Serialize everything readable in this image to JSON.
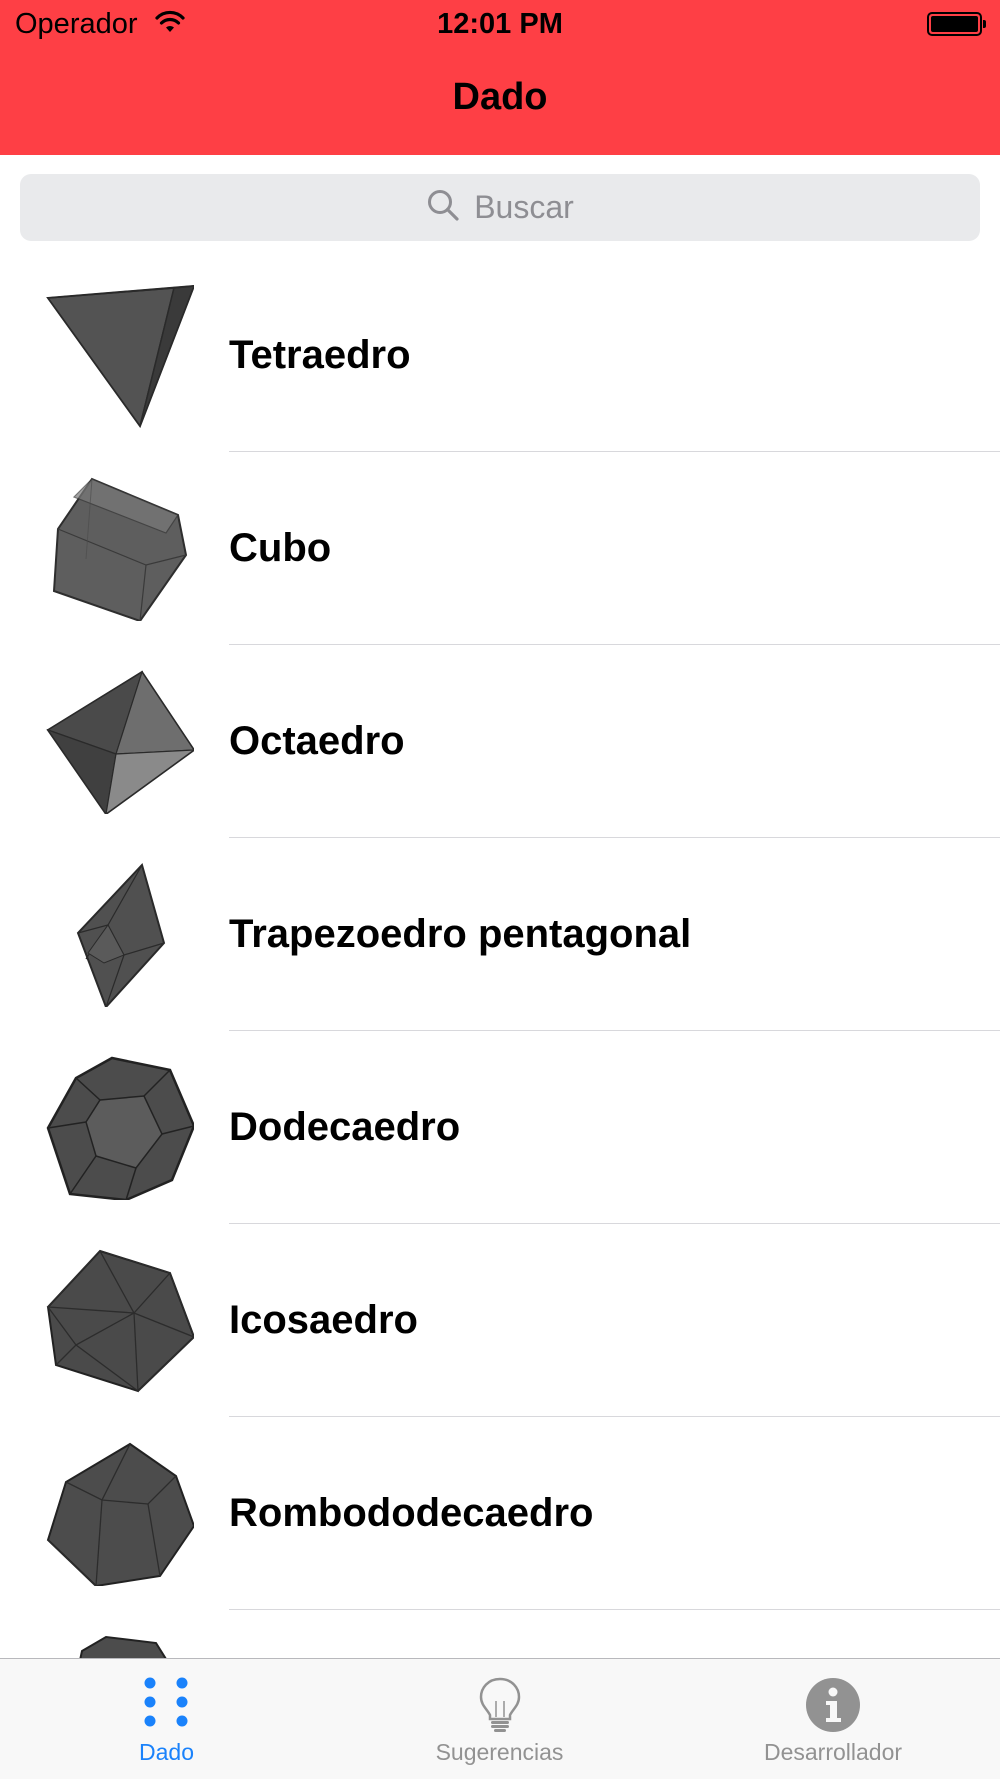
{
  "status_bar": {
    "carrier": "Operador",
    "time": "12:01 PM"
  },
  "nav": {
    "title": "Dado"
  },
  "search": {
    "placeholder": "Buscar"
  },
  "items": [
    {
      "label": "Tetraedro",
      "icon": "tetrahedron-icon"
    },
    {
      "label": "Cubo",
      "icon": "cube-icon"
    },
    {
      "label": "Octaedro",
      "icon": "octahedron-icon"
    },
    {
      "label": "Trapezoedro pentagonal",
      "icon": "pentagonal-trapezohedron-icon"
    },
    {
      "label": "Dodecaedro",
      "icon": "dodecahedron-icon"
    },
    {
      "label": "Icosaedro",
      "icon": "icosahedron-icon"
    },
    {
      "label": "Rombododecaedro",
      "icon": "rhombic-dodecahedron-icon"
    }
  ],
  "tabs": [
    {
      "label": "Dado",
      "icon": "dice-dots-icon",
      "selected": true
    },
    {
      "label": "Sugerencias",
      "icon": "lightbulb-icon",
      "selected": false
    },
    {
      "label": "Desarrollador",
      "icon": "info-icon",
      "selected": false
    }
  ],
  "colors": {
    "nav_bar": "#fe3f45",
    "tab_active": "#1a82fb",
    "tab_inactive": "#929292",
    "shape": "#4a4a4a"
  }
}
